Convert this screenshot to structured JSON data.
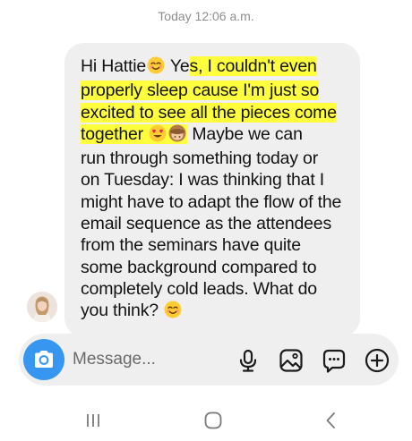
{
  "thread": {
    "timestamp": "Today 12:06 a.m."
  },
  "message": {
    "lines": [
      {
        "a": "Hi Hattie",
        "b": " Ye",
        "c": "s, I couldn't even"
      },
      {
        "a": "properly sleep cause I'm just so"
      },
      {
        "a": "excited to see all the pieces come"
      },
      {
        "a": "together ",
        "b": " Maybe we can"
      },
      {
        "a": "run through something today or"
      },
      {
        "a": "on Tuesday: I was thinking that I"
      },
      {
        "a": "might have to adapt the flow of the"
      },
      {
        "a": "email sequence as the attendees"
      },
      {
        "a": "from the seminars have quite"
      },
      {
        "a": "some background compared to"
      },
      {
        "a": "completely cold leads. What do"
      },
      {
        "a": "you think? "
      }
    ],
    "highlight_color": "#ffff3d"
  },
  "composer": {
    "placeholder": "Message...",
    "camera_icon": "camera-icon",
    "tools": [
      "microphone-icon",
      "gallery-icon",
      "sticker-icon",
      "add-icon"
    ],
    "accent": "#3797f0"
  },
  "navbar": {
    "buttons": [
      "recent-apps-icon",
      "home-icon",
      "back-icon"
    ]
  }
}
